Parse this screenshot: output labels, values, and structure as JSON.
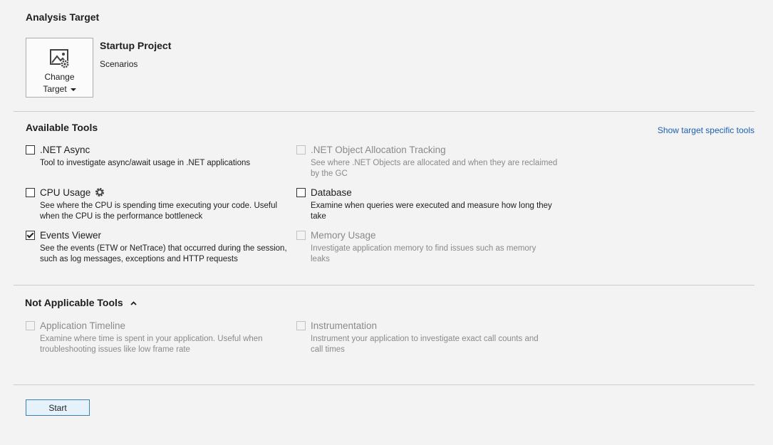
{
  "analysis_target": {
    "title": "Analysis Target",
    "change_target_line1": "Change",
    "change_target_line2": "Target",
    "project_name": "Startup Project",
    "project_sub": "Scenarios"
  },
  "available_tools": {
    "title": "Available Tools",
    "link": "Show target specific tools",
    "tools": [
      {
        "name": ".NET Async",
        "desc1": "Tool to investigate async/await usage in .NET applications",
        "desc2": "",
        "checked": false,
        "enabled": true
      },
      {
        "name": ".NET Object Allocation Tracking",
        "desc1": "See where .NET Objects are allocated and when they are reclaimed",
        "desc2": "by the GC",
        "checked": false,
        "enabled": false
      },
      {
        "name": "CPU Usage",
        "desc1": "See where the CPU is spending time executing your code. Useful",
        "desc2": "when the CPU is the performance bottleneck",
        "checked": false,
        "enabled": true
      },
      {
        "name": "Database",
        "desc1": "Examine when queries were executed and measure how long they",
        "desc2": "take",
        "checked": false,
        "enabled": true
      },
      {
        "name": "Events Viewer",
        "desc1": "See the events (ETW or NetTrace) that occurred during the session,",
        "desc2": "such as log messages, exceptions and HTTP requests",
        "checked": true,
        "enabled": true
      },
      {
        "name": "Memory Usage",
        "desc1": "Investigate application memory to find issues such as memory",
        "desc2": "leaks",
        "checked": false,
        "enabled": false
      }
    ]
  },
  "not_applicable": {
    "title": "Not Applicable Tools",
    "tools": [
      {
        "name": "Application Timeline",
        "desc1": "Examine where time is spent in your application. Useful when",
        "desc2": "troubleshooting issues like low frame rate"
      },
      {
        "name": "Instrumentation",
        "desc1": "Instrument your application to investigate exact call counts and",
        "desc2": "call times"
      }
    ]
  },
  "footer": {
    "start_label": "Start"
  }
}
